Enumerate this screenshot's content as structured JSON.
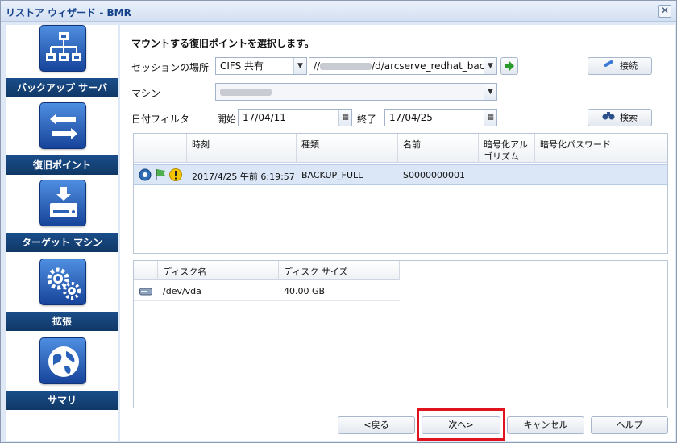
{
  "window": {
    "title": "リストア ウィザード - BMR",
    "close_glyph": "✕"
  },
  "sidebar": {
    "steps": [
      {
        "label": "バックアップ サーバ",
        "icon": "network-tree-icon"
      },
      {
        "label": "復旧ポイント",
        "icon": "arrows-icon"
      },
      {
        "label": "ターゲット マシン",
        "icon": "drive-download-icon"
      },
      {
        "label": "拡張",
        "icon": "gears-icon"
      },
      {
        "label": "サマリ",
        "icon": "globe-icon"
      }
    ]
  },
  "main": {
    "heading": "マウントする復旧ポイントを選択します。",
    "session_label": "セッションの場所",
    "session_type": "CIFS 共有",
    "session_path_prefix": "//",
    "session_path_suffix": "/d/arcserve_redhat_backı",
    "connect_label": "接続",
    "machine_label": "マシン",
    "date_filter_label": "日付フィルタ",
    "start_label": "開始",
    "start_date": "17/04/11",
    "end_label": "終了",
    "end_date": "17/04/25",
    "search_label": "検索"
  },
  "recovery_table": {
    "headers": [
      "時刻",
      "種類",
      "名前",
      "暗号化アルゴリズム",
      "暗号化パスワード"
    ],
    "header_line1": "暗号化アル",
    "header_line2": "ゴリズム",
    "rows": [
      {
        "time": "2017/4/25 午前 6:19:57",
        "type": "BACKUP_FULL",
        "name": "S0000000001",
        "algorithm": "",
        "password": ""
      }
    ]
  },
  "disk_table": {
    "headers": [
      "ディスク名",
      "ディスク サイズ"
    ],
    "rows": [
      {
        "name": "/dev/vda",
        "size": "40.00 GB"
      }
    ]
  },
  "footer": {
    "back": "<戻る",
    "next": "次へ>",
    "cancel": "キャンセル",
    "help": "ヘルプ"
  },
  "colors": {
    "accent": "#15428b",
    "highlight_box": "#e0141e",
    "selected_row": "#dbe6f6"
  }
}
